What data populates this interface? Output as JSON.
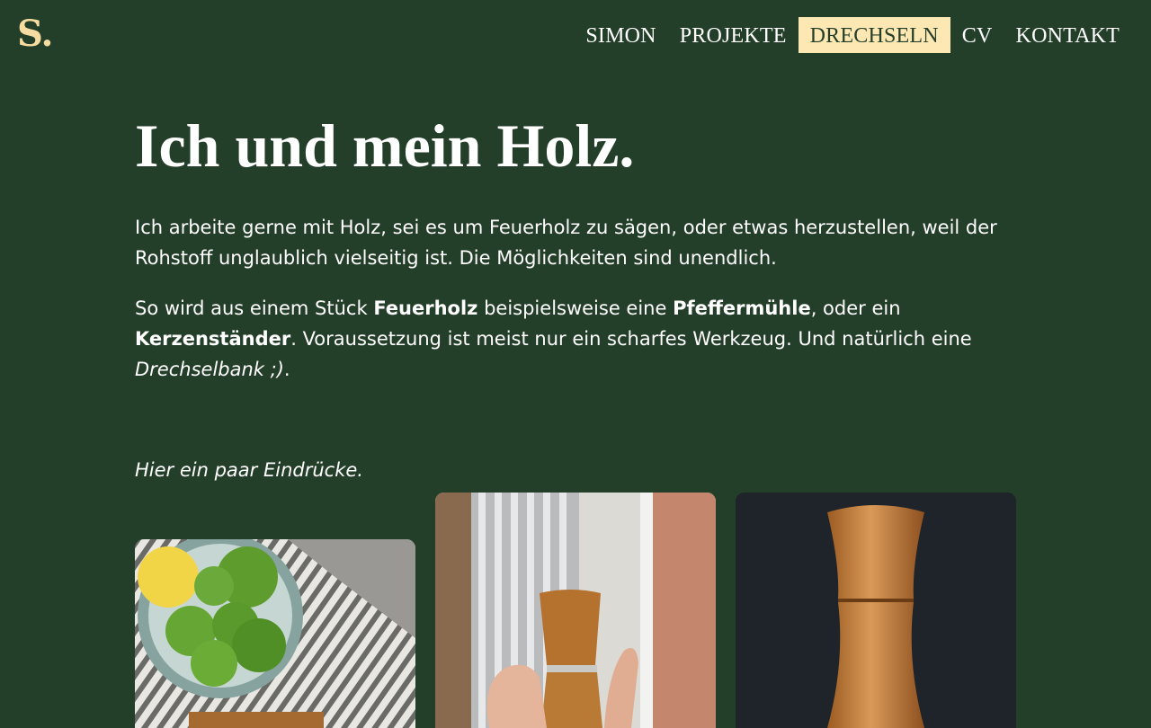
{
  "brand": {
    "logo": "S."
  },
  "nav": {
    "items": [
      {
        "label": "SIMON"
      },
      {
        "label": "PROJEKTE"
      },
      {
        "label": "DRECHSELN",
        "active": true
      },
      {
        "label": "CV"
      },
      {
        "label": "KONTAKT"
      }
    ]
  },
  "page": {
    "title": "Ich und mein Holz.",
    "intro": "Ich arbeite gerne mit Holz, sei es um Feuerholz zu sägen, oder etwas herzustellen, weil der Rohstoff unglaublich vielseitig ist. Die Möglichkeiten sind unendlich.",
    "p2_a": "So wird aus einem Stück ",
    "p2_b": "Feuerholz",
    "p2_c": " beispielsweise eine ",
    "p2_d": "Pfeffermühle",
    "p2_e": ", oder ein ",
    "p2_f": "Kerzenständer",
    "p2_g": ". Voraussetzung ist meist nur ein scharfes Werkzeug. Und natürlich eine ",
    "p2_h": "Drechselbank ;)",
    "p2_i": ".",
    "gallery_caption": "Hier ein paar Eindrücke."
  },
  "colors": {
    "background": "#243f29",
    "accent": "#fde7b3",
    "logo": "#f7dca2",
    "text": "#ffffff"
  }
}
